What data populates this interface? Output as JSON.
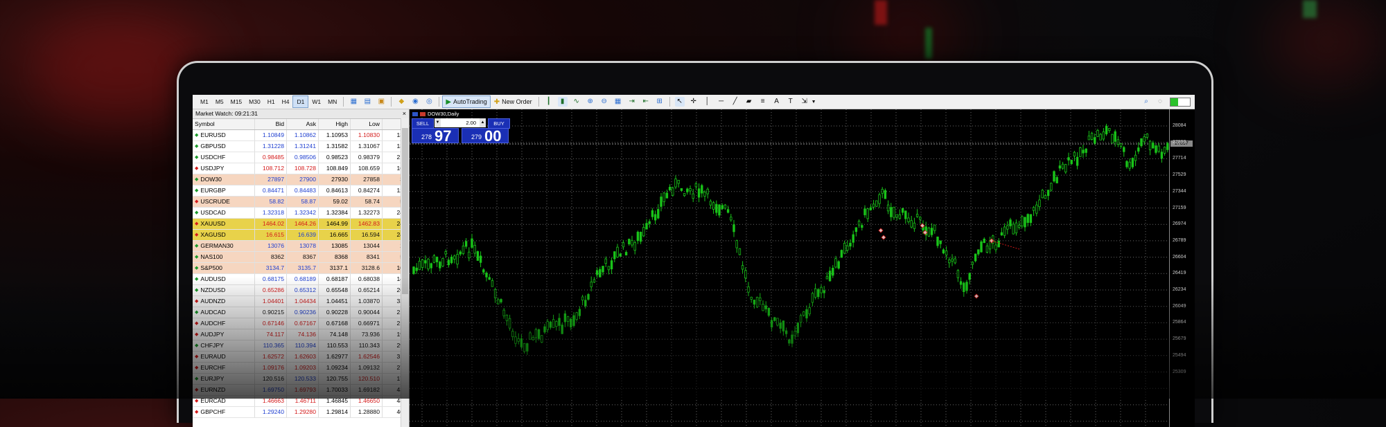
{
  "toolbar": {
    "timeframes": [
      "M1",
      "M5",
      "M15",
      "M30",
      "H1",
      "H4",
      "D1",
      "W1",
      "MN"
    ],
    "active_timeframe": "D1",
    "auto_trading_label": "AutoTrading",
    "new_order_label": "New Order"
  },
  "market_watch": {
    "title": "Market Watch: 09:21:31",
    "close_glyph": "×",
    "columns": [
      "Symbol",
      "Bid",
      "Ask",
      "High",
      "Low",
      "!"
    ],
    "rows": [
      {
        "symbol": "EURUSD",
        "bid": "1.10849",
        "ask": "1.10862",
        "high": "1.10953",
        "low": "1.10830",
        "spread": "13",
        "dir": "up",
        "bg": "#ffffff",
        "bidc": "#1f3fd0",
        "askc": "#1f3fd0",
        "lowc": "#d41a1a"
      },
      {
        "symbol": "GBPUSD",
        "bid": "1.31228",
        "ask": "1.31241",
        "high": "1.31582",
        "low": "1.31067",
        "spread": "13",
        "dir": "up",
        "bg": "#ffffff",
        "bidc": "#1f3fd0",
        "askc": "#1f3fd0",
        "lowc": "#111"
      },
      {
        "symbol": "USDCHF",
        "bid": "0.98485",
        "ask": "0.98506",
        "high": "0.98523",
        "low": "0.98379",
        "spread": "21",
        "dir": "up",
        "bg": "#ffffff",
        "bidc": "#d41a1a",
        "askc": "#1f3fd0",
        "lowc": "#111"
      },
      {
        "symbol": "USDJPY",
        "bid": "108.712",
        "ask": "108.728",
        "high": "108.849",
        "low": "108.659",
        "spread": "16",
        "dir": "down",
        "bg": "#ffffff",
        "bidc": "#d41a1a",
        "askc": "#d41a1a",
        "lowc": "#111"
      },
      {
        "symbol": "DOW30",
        "bid": "27897",
        "ask": "27900",
        "high": "27930",
        "low": "27858",
        "spread": "3",
        "dir": "up",
        "bg": "#f6d6c0",
        "bidc": "#1f3fd0",
        "askc": "#1f3fd0",
        "lowc": "#111"
      },
      {
        "symbol": "EURGBP",
        "bid": "0.84471",
        "ask": "0.84483",
        "high": "0.84613",
        "low": "0.84274",
        "spread": "12",
        "dir": "up",
        "bg": "#ffffff",
        "bidc": "#1f3fd0",
        "askc": "#1f3fd0",
        "lowc": "#111"
      },
      {
        "symbol": "USCRUDE",
        "bid": "58.82",
        "ask": "58.87",
        "high": "59.02",
        "low": "58.74",
        "spread": "5",
        "dir": "down",
        "bg": "#f6d6c0",
        "bidc": "#1f3fd0",
        "askc": "#1f3fd0",
        "lowc": "#111"
      },
      {
        "symbol": "USDCAD",
        "bid": "1.32318",
        "ask": "1.32342",
        "high": "1.32384",
        "low": "1.32273",
        "spread": "24",
        "dir": "up",
        "bg": "#ffffff",
        "bidc": "#1f3fd0",
        "askc": "#1f3fd0",
        "lowc": "#111"
      },
      {
        "symbol": "XAUUSD",
        "bid": "1464.02",
        "ask": "1464.26",
        "high": "1464.99",
        "low": "1462.83",
        "spread": "24",
        "dir": "down",
        "bg": "#e8d24a",
        "bidc": "#d41a1a",
        "askc": "#d41a1a",
        "lowc": "#d41a1a"
      },
      {
        "symbol": "XAGUSD",
        "bid": "16.615",
        "ask": "16.639",
        "high": "16.665",
        "low": "16.594",
        "spread": "24",
        "dir": "down",
        "bg": "#e8d24a",
        "bidc": "#d41a1a",
        "askc": "#1f3fd0",
        "lowc": "#111"
      },
      {
        "symbol": "GERMAN30",
        "bid": "13076",
        "ask": "13078",
        "high": "13085",
        "low": "13044",
        "spread": "2",
        "dir": "up",
        "bg": "#f6d6c0",
        "bidc": "#1f3fd0",
        "askc": "#1f3fd0",
        "lowc": "#111"
      },
      {
        "symbol": "NAS100",
        "bid": "8362",
        "ask": "8367",
        "high": "8368",
        "low": "8341",
        "spread": "5",
        "dir": "up",
        "bg": "#f6d6c0",
        "bidc": "#111",
        "askc": "#111",
        "lowc": "#111"
      },
      {
        "symbol": "S&P500",
        "bid": "3134.7",
        "ask": "3135.7",
        "high": "3137.1",
        "low": "3128.6",
        "spread": "10",
        "dir": "up",
        "bg": "#f6d6c0",
        "bidc": "#1f3fd0",
        "askc": "#1f3fd0",
        "lowc": "#111"
      },
      {
        "symbol": "AUDUSD",
        "bid": "0.68175",
        "ask": "0.68189",
        "high": "0.68187",
        "low": "0.68038",
        "spread": "14",
        "dir": "up",
        "bg": "#ffffff",
        "bidc": "#1f3fd0",
        "askc": "#1f3fd0",
        "lowc": "#111"
      },
      {
        "symbol": "NZDUSD",
        "bid": "0.65286",
        "ask": "0.65312",
        "high": "0.65548",
        "low": "0.65214",
        "spread": "26",
        "dir": "up",
        "bg": "#ffffff",
        "bidc": "#d41a1a",
        "askc": "#1f3fd0",
        "lowc": "#111"
      },
      {
        "symbol": "AUDNZD",
        "bid": "1.04401",
        "ask": "1.04434",
        "high": "1.04451",
        "low": "1.03870",
        "spread": "33",
        "dir": "down",
        "bg": "#ffffff",
        "bidc": "#d41a1a",
        "askc": "#d41a1a",
        "lowc": "#111"
      },
      {
        "symbol": "AUDCAD",
        "bid": "0.90215",
        "ask": "0.90236",
        "high": "0.90228",
        "low": "0.90044",
        "spread": "21",
        "dir": "up",
        "bg": "#ffffff",
        "bidc": "#111",
        "askc": "#1f3fd0",
        "lowc": "#111"
      },
      {
        "symbol": "AUDCHF",
        "bid": "0.67146",
        "ask": "0.67167",
        "high": "0.67168",
        "low": "0.66971",
        "spread": "21",
        "dir": "down",
        "bg": "#ffffff",
        "bidc": "#d41a1a",
        "askc": "#d41a1a",
        "lowc": "#111"
      },
      {
        "symbol": "AUDJPY",
        "bid": "74.117",
        "ask": "74.136",
        "high": "74.148",
        "low": "73.936",
        "spread": "19",
        "dir": "down",
        "bg": "#ffffff",
        "bidc": "#d41a1a",
        "askc": "#d41a1a",
        "lowc": "#111"
      },
      {
        "symbol": "CHFJPY",
        "bid": "110.365",
        "ask": "110.394",
        "high": "110.553",
        "low": "110.343",
        "spread": "29",
        "dir": "up",
        "bg": "#ffffff",
        "bidc": "#1f3fd0",
        "askc": "#1f3fd0",
        "lowc": "#111"
      },
      {
        "symbol": "EURAUD",
        "bid": "1.62572",
        "ask": "1.62603",
        "high": "1.62977",
        "low": "1.62546",
        "spread": "31",
        "dir": "down",
        "bg": "#ffffff",
        "bidc": "#d41a1a",
        "askc": "#d41a1a",
        "lowc": "#d41a1a"
      },
      {
        "symbol": "EURCHF",
        "bid": "1.09176",
        "ask": "1.09203",
        "high": "1.09234",
        "low": "1.09132",
        "spread": "27",
        "dir": "down",
        "bg": "#ffffff",
        "bidc": "#d41a1a",
        "askc": "#d41a1a",
        "lowc": "#111"
      },
      {
        "symbol": "EURJPY",
        "bid": "120.516",
        "ask": "120.533",
        "high": "120.755",
        "low": "120.510",
        "spread": "17",
        "dir": "up",
        "bg": "#ffffff",
        "bidc": "#111",
        "askc": "#1f3fd0",
        "lowc": "#d41a1a"
      },
      {
        "symbol": "EURNZD",
        "bid": "1.69750",
        "ask": "1.69793",
        "high": "1.70033",
        "low": "1.69182",
        "spread": "43",
        "dir": "down",
        "bg": "#ffffff",
        "bidc": "#1f3fd0",
        "askc": "#d41a1a",
        "lowc": "#111"
      },
      {
        "symbol": "EURCAD",
        "bid": "1.46663",
        "ask": "1.46711",
        "high": "1.46845",
        "low": "1.46650",
        "spread": "48",
        "dir": "down",
        "bg": "#ffffff",
        "bidc": "#d41a1a",
        "askc": "#d41a1a",
        "lowc": "#d41a1a"
      },
      {
        "symbol": "GBPCHF",
        "bid": "1.29240",
        "ask": "1.29280",
        "high": "1.29814",
        "low": "1.28880",
        "spread": "40",
        "dir": "down",
        "bg": "#ffffff",
        "bidc": "#1f3fd0",
        "askc": "#d41a1a",
        "lowc": "#111"
      }
    ]
  },
  "chart": {
    "symbol_label": "DOW30,Daily",
    "sell_label": "SELL",
    "buy_label": "BUY",
    "lot_value": "2.00",
    "sell_small": "278",
    "sell_big": "97",
    "buy_small": "279",
    "buy_big": "00",
    "current_price_tag": "27897",
    "price_axis": [
      "28084",
      "27899",
      "27714",
      "27529",
      "27344",
      "27159",
      "26974",
      "26789",
      "26604",
      "26419",
      "26234",
      "26049",
      "25864",
      "25679",
      "25494",
      "25309"
    ]
  },
  "colors": {
    "candle": "#19c419",
    "grid": "#6a6a6a",
    "oneclick_blue": "#1a2fb5"
  }
}
